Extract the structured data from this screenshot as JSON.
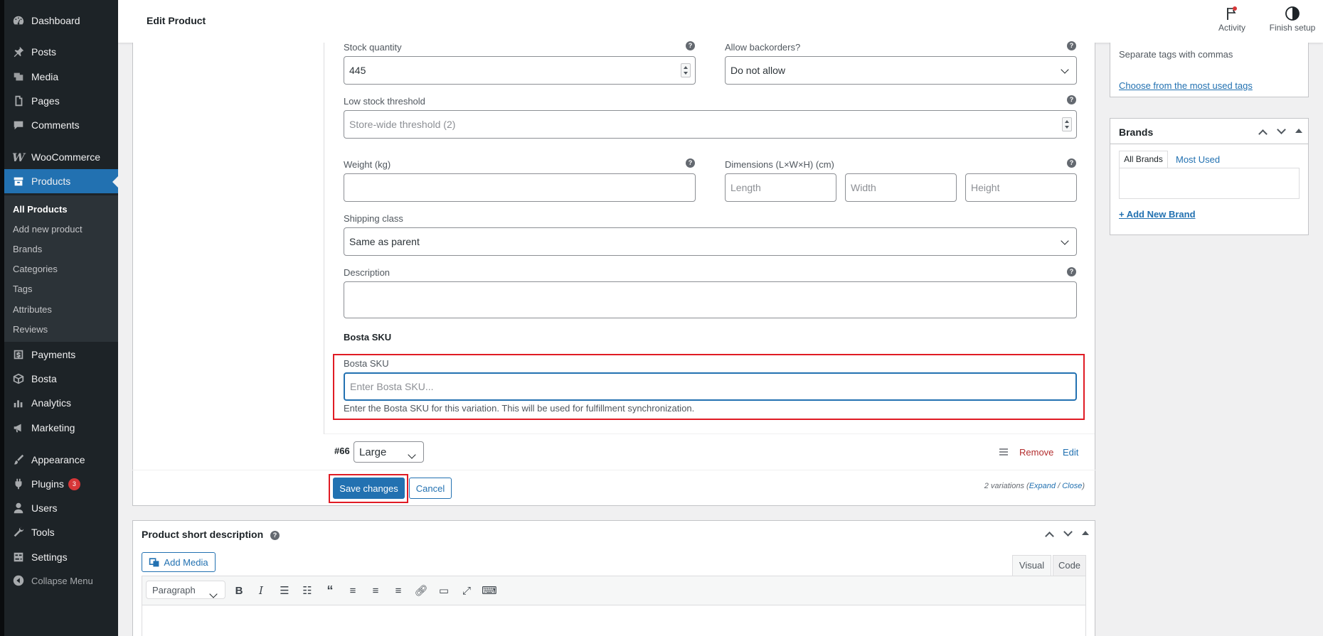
{
  "sidebar": {
    "menu": [
      {
        "label": "Dashboard",
        "icon": "dashboard-icon"
      },
      {
        "label": "Posts",
        "icon": "pin-icon"
      },
      {
        "label": "Media",
        "icon": "media-icon"
      },
      {
        "label": "Pages",
        "icon": "pages-icon"
      },
      {
        "label": "Comments",
        "icon": "comment-icon"
      },
      {
        "label": "WooCommerce",
        "icon": "woocommerce-icon"
      },
      {
        "label": "Products",
        "icon": "products-icon"
      },
      {
        "label": "Payments",
        "icon": "payments-icon"
      },
      {
        "label": "Bosta",
        "icon": "box-icon"
      },
      {
        "label": "Analytics",
        "icon": "chart-icon"
      },
      {
        "label": "Marketing",
        "icon": "megaphone-icon"
      },
      {
        "label": "Appearance",
        "icon": "brush-icon"
      },
      {
        "label": "Plugins",
        "icon": "plug-icon",
        "badge": "3"
      },
      {
        "label": "Users",
        "icon": "user-icon"
      },
      {
        "label": "Tools",
        "icon": "wrench-icon"
      },
      {
        "label": "Settings",
        "icon": "settings-icon"
      }
    ],
    "submenu": [
      "All Products",
      "Add new product",
      "Brands",
      "Categories",
      "Tags",
      "Attributes",
      "Reviews"
    ],
    "collapse_label": "Collapse Menu"
  },
  "topbar": {
    "title": "Edit Product",
    "activity_label": "Activity",
    "finish_setup_label": "Finish setup"
  },
  "variation": {
    "stock_quantity_label": "Stock quantity",
    "stock_quantity_value": "445",
    "allow_backorders_label": "Allow backorders?",
    "allow_backorders_value": "Do not allow",
    "low_stock_label": "Low stock threshold",
    "low_stock_placeholder": "Store-wide threshold (2)",
    "weight_label": "Weight (kg)",
    "dimensions_label": "Dimensions (L×W×H) (cm)",
    "length_placeholder": "Length",
    "width_placeholder": "Width",
    "height_placeholder": "Height",
    "shipping_class_label": "Shipping class",
    "shipping_class_value": "Same as parent",
    "description_label": "Description",
    "bosta_heading": "Bosta SKU",
    "bosta_label": "Bosta SKU",
    "bosta_placeholder": "Enter Bosta SKU...",
    "bosta_hint": "Enter the Bosta SKU for this variation. This will be used for fulfillment synchronization."
  },
  "variation_row": {
    "id": "#66",
    "size_value": "Large",
    "remove_label": "Remove",
    "edit_label": "Edit"
  },
  "actions": {
    "save_label": "Save changes",
    "cancel_label": "Cancel",
    "count_text": "2 variations (",
    "expand_label": "Expand",
    "separator": " / ",
    "close_label": "Close",
    "count_end": ")"
  },
  "tags_box": {
    "hint": "Separate tags with commas",
    "choose_link": "Choose from the most used tags"
  },
  "brands_box": {
    "title": "Brands",
    "tab_all": "All Brands",
    "tab_most_used": "Most Used",
    "add_link": "+ Add New Brand"
  },
  "short_description": {
    "title": "Product short description",
    "add_media_label": "Add Media",
    "tab_visual": "Visual",
    "tab_code": "Code",
    "format_value": "Paragraph"
  }
}
